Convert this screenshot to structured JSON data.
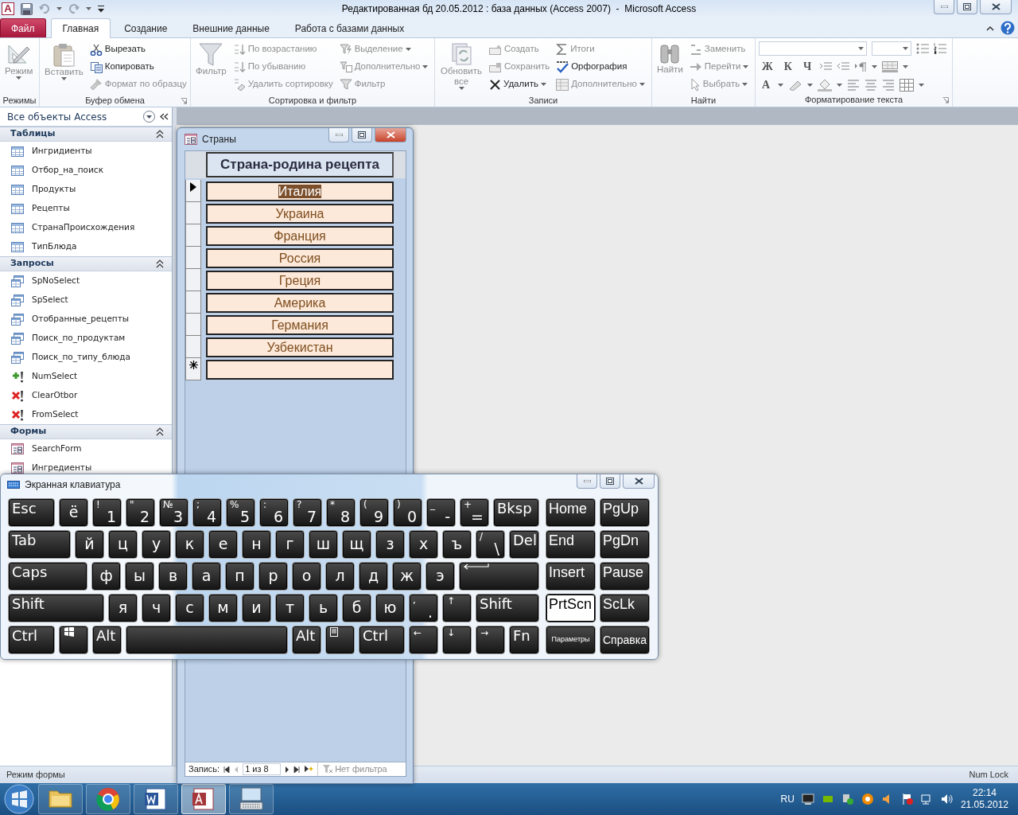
{
  "window": {
    "logo": "A",
    "title": "Редактированная бд 20.05.2012 : база данных (Access 2007)  -  Microsoft Access"
  },
  "ribbon": {
    "tabs": [
      {
        "label": "Файл",
        "kind": "file",
        "selected": false
      },
      {
        "label": "Главная",
        "kind": "tab",
        "selected": true
      },
      {
        "label": "Создание",
        "kind": "tab",
        "selected": false
      },
      {
        "label": "Внешние данные",
        "kind": "tab",
        "selected": false
      },
      {
        "label": "Работа с базами данных",
        "kind": "tab",
        "selected": false
      }
    ],
    "groups": [
      {
        "label": "Режимы",
        "kind": "commands",
        "launcher": false,
        "large": [
          {
            "label": "Режим",
            "disabled": true,
            "dropdown": true
          }
        ]
      },
      {
        "label": "Буфер обмена",
        "kind": "commands",
        "launcher": true,
        "large": [
          {
            "label": "Вставить",
            "disabled": true,
            "dropdown": true
          }
        ],
        "columns": [
          [
            {
              "label": "Вырезать",
              "disabled": false,
              "dropdown": false
            },
            {
              "label": "Копировать",
              "disabled": false,
              "dropdown": false
            },
            {
              "label": "Формат по образцу",
              "disabled": true,
              "dropdown": false
            }
          ]
        ]
      },
      {
        "label": "Сортировка и фильтр",
        "kind": "commands",
        "launcher": false,
        "large": [
          {
            "label": "Фильтр",
            "disabled": true,
            "dropdown": false
          }
        ],
        "columns": [
          [
            {
              "label": "По возрастанию",
              "disabled": true,
              "dropdown": false
            },
            {
              "label": "По убыванию",
              "disabled": true,
              "dropdown": false
            },
            {
              "label": "Удалить сортировку",
              "disabled": true,
              "dropdown": false
            }
          ],
          [
            {
              "label": "Выделение",
              "disabled": true,
              "dropdown": true
            },
            {
              "label": "Дополнительно",
              "disabled": true,
              "dropdown": true
            },
            {
              "label": "Фильтр",
              "disabled": true,
              "dropdown": false
            }
          ]
        ]
      },
      {
        "label": "Записи",
        "kind": "commands",
        "launcher": false,
        "large": [
          {
            "label": "Обновить все",
            "disabled": true,
            "dropdown": true
          }
        ],
        "columns": [
          [
            {
              "label": "Создать",
              "disabled": true,
              "dropdown": false
            },
            {
              "label": "Сохранить",
              "disabled": true,
              "dropdown": false
            },
            {
              "label": "Удалить",
              "disabled": false,
              "dropdown": true
            }
          ],
          [
            {
              "label": "Итоги",
              "disabled": true,
              "dropdown": false
            },
            {
              "label": "Орфография",
              "disabled": false,
              "dropdown": false
            },
            {
              "label": "Дополнительно",
              "disabled": true,
              "dropdown": true
            }
          ]
        ]
      },
      {
        "label": "Найти",
        "kind": "commands",
        "launcher": false,
        "large": [
          {
            "label": "Найти",
            "disabled": true,
            "dropdown": false
          }
        ],
        "columns": [
          [
            {
              "label": "Заменить",
              "disabled": true,
              "dropdown": false
            },
            {
              "label": "Перейти",
              "disabled": true,
              "dropdown": true
            },
            {
              "label": "Выбрать",
              "disabled": true,
              "dropdown": true
            }
          ]
        ]
      },
      {
        "label": "Форматирование текста",
        "kind": "format",
        "launcher": true,
        "letters": [
          "Ж",
          "К",
          "Ч"
        ],
        "color_letter": "A"
      }
    ]
  },
  "nav_pane": {
    "title": "Все объекты Access",
    "sections": [
      {
        "label": "Таблицы",
        "expanded": true,
        "items": [
          {
            "label": "Ингридиенты",
            "kind": "table"
          },
          {
            "label": "Отбор_на_поиск",
            "kind": "table"
          },
          {
            "label": "Продукты",
            "kind": "table"
          },
          {
            "label": "Рецепты",
            "kind": "table"
          },
          {
            "label": "СтранаПроисхождения",
            "kind": "table"
          },
          {
            "label": "ТипБлюда",
            "kind": "table"
          }
        ]
      },
      {
        "label": "Запросы",
        "expanded": true,
        "items": [
          {
            "label": "SpNoSelect",
            "kind": "select"
          },
          {
            "label": "SpSelect",
            "kind": "select"
          },
          {
            "label": "Отобранные_рецепты",
            "kind": "select"
          },
          {
            "label": "Поиск_по_продуктам",
            "kind": "select"
          },
          {
            "label": "Поиск_по_типу_блюда",
            "kind": "select"
          },
          {
            "label": "NumSelect",
            "kind": "append"
          },
          {
            "label": "ClearOtbor",
            "kind": "delete"
          },
          {
            "label": "FromSelect",
            "kind": "delete"
          }
        ]
      },
      {
        "label": "Формы",
        "expanded": true,
        "items": [
          {
            "label": "SearchForm",
            "kind": "form"
          },
          {
            "label": "Ингредиенты",
            "kind": "form"
          }
        ]
      }
    ]
  },
  "form_window": {
    "title": "Страны",
    "header": "Страна-родина рецепта",
    "rows": [
      {
        "value": "Италия",
        "current": true
      },
      {
        "value": "Украина",
        "current": false
      },
      {
        "value": "Франция",
        "current": false
      },
      {
        "value": "Россия",
        "current": false
      },
      {
        "value": "Греция",
        "current": false
      },
      {
        "value": "Америка",
        "current": false
      },
      {
        "value": "Германия",
        "current": false
      },
      {
        "value": "Узбекистан",
        "current": false
      }
    ],
    "record_nav": {
      "label": "Запись:",
      "position": "1 из 8",
      "filter": "Нет фильтра"
    }
  },
  "keyboard": {
    "title": "Экранная клавиатура",
    "rows": [
      {
        "keys": [
          {
            "kind": "label",
            "main": "Esc"
          },
          {
            "kind": "letter",
            "main": "ё"
          },
          {
            "kind": "pair",
            "top": "!",
            "main": "1"
          },
          {
            "kind": "pair",
            "top": "\"",
            "main": "2"
          },
          {
            "kind": "pair",
            "top": "№",
            "main": "3"
          },
          {
            "kind": "pair",
            "top": ";",
            "main": "4"
          },
          {
            "kind": "pair",
            "top": "%",
            "main": "5"
          },
          {
            "kind": "pair",
            "top": ":",
            "main": "6"
          },
          {
            "kind": "pair",
            "top": "?",
            "main": "7"
          },
          {
            "kind": "pair",
            "top": "*",
            "main": "8"
          },
          {
            "kind": "pair",
            "top": "(",
            "main": "9"
          },
          {
            "kind": "pair",
            "top": ")",
            "main": "0"
          },
          {
            "kind": "pair",
            "top": "_",
            "main": "-"
          },
          {
            "kind": "pair",
            "top": "+",
            "main": "="
          },
          {
            "kind": "label",
            "main": "Bksp"
          }
        ]
      },
      {
        "keys": [
          {
            "kind": "label",
            "main": "Tab"
          },
          {
            "kind": "letter",
            "main": "й"
          },
          {
            "kind": "letter",
            "main": "ц"
          },
          {
            "kind": "letter",
            "main": "у"
          },
          {
            "kind": "letter",
            "main": "к"
          },
          {
            "kind": "letter",
            "main": "е"
          },
          {
            "kind": "letter",
            "main": "н"
          },
          {
            "kind": "letter",
            "main": "г"
          },
          {
            "kind": "letter",
            "main": "ш"
          },
          {
            "kind": "letter",
            "main": "щ"
          },
          {
            "kind": "letter",
            "main": "з"
          },
          {
            "kind": "letter",
            "main": "х"
          },
          {
            "kind": "letter",
            "main": "ъ"
          },
          {
            "kind": "pair",
            "top": "/",
            "main": "\\"
          },
          {
            "kind": "label",
            "main": "Del"
          }
        ]
      },
      {
        "keys": [
          {
            "kind": "label",
            "main": "Caps"
          },
          {
            "kind": "letter",
            "main": "ф"
          },
          {
            "kind": "letter",
            "main": "ы"
          },
          {
            "kind": "letter",
            "main": "в"
          },
          {
            "kind": "letter",
            "main": "а"
          },
          {
            "kind": "letter",
            "main": "п"
          },
          {
            "kind": "letter",
            "main": "р"
          },
          {
            "kind": "letter",
            "main": "о"
          },
          {
            "kind": "letter",
            "main": "л"
          },
          {
            "kind": "letter",
            "main": "д"
          },
          {
            "kind": "letter",
            "main": "ж"
          },
          {
            "kind": "letter",
            "main": "э"
          },
          {
            "kind": "enter"
          }
        ]
      },
      {
        "keys": [
          {
            "kind": "label",
            "main": "Shift"
          },
          {
            "kind": "letter",
            "main": "я"
          },
          {
            "kind": "letter",
            "main": "ч"
          },
          {
            "kind": "letter",
            "main": "с"
          },
          {
            "kind": "letter",
            "main": "м"
          },
          {
            "kind": "letter",
            "main": "и"
          },
          {
            "kind": "letter",
            "main": "т"
          },
          {
            "kind": "letter",
            "main": "ь"
          },
          {
            "kind": "letter",
            "main": "б"
          },
          {
            "kind": "letter",
            "main": "ю"
          },
          {
            "kind": "pair",
            "top": ",",
            "main": "."
          },
          {
            "kind": "arrow",
            "main": "↑"
          },
          {
            "kind": "label",
            "main": "Shift"
          }
        ]
      },
      {
        "keys": [
          {
            "kind": "label",
            "main": "Ctrl"
          },
          {
            "kind": "windows"
          },
          {
            "kind": "label",
            "main": "Alt"
          },
          {
            "kind": "space"
          },
          {
            "kind": "label",
            "main": "Alt"
          },
          {
            "kind": "menu"
          },
          {
            "kind": "label",
            "main": "Ctrl"
          },
          {
            "kind": "arrow",
            "main": "←"
          },
          {
            "kind": "arrow",
            "main": "↓"
          },
          {
            "kind": "arrow",
            "main": "→"
          },
          {
            "kind": "label",
            "main": "Fn"
          }
        ]
      }
    ],
    "nav_rows": [
      {
        "keys": [
          {
            "main": "Home",
            "on": false
          },
          {
            "main": "PgUp",
            "on": false
          }
        ]
      },
      {
        "keys": [
          {
            "main": "End",
            "on": false
          },
          {
            "main": "PgDn",
            "on": false
          }
        ]
      },
      {
        "keys": [
          {
            "main": "Insert",
            "on": false
          },
          {
            "main": "Pause",
            "on": false
          }
        ]
      },
      {
        "keys": [
          {
            "main": "PrtScn",
            "on": true
          },
          {
            "main": "ScLk",
            "on": false
          }
        ]
      },
      {
        "keys": [
          {
            "main": "Параметры",
            "on": false,
            "kind": "small"
          },
          {
            "main": "Справка",
            "on": false,
            "kind": "medium"
          }
        ]
      }
    ]
  },
  "status_bar": {
    "left": "Режим формы",
    "right": "Num Lock"
  },
  "taskbar": {
    "apps": [
      {
        "kind": "folder",
        "active": false
      },
      {
        "kind": "browser",
        "active": false
      },
      {
        "kind": "word",
        "active": false
      },
      {
        "kind": "access",
        "active": true
      },
      {
        "kind": "keyboard",
        "active": false
      }
    ],
    "language": "RU",
    "time": "22:14",
    "date": "21.05.2012"
  }
}
